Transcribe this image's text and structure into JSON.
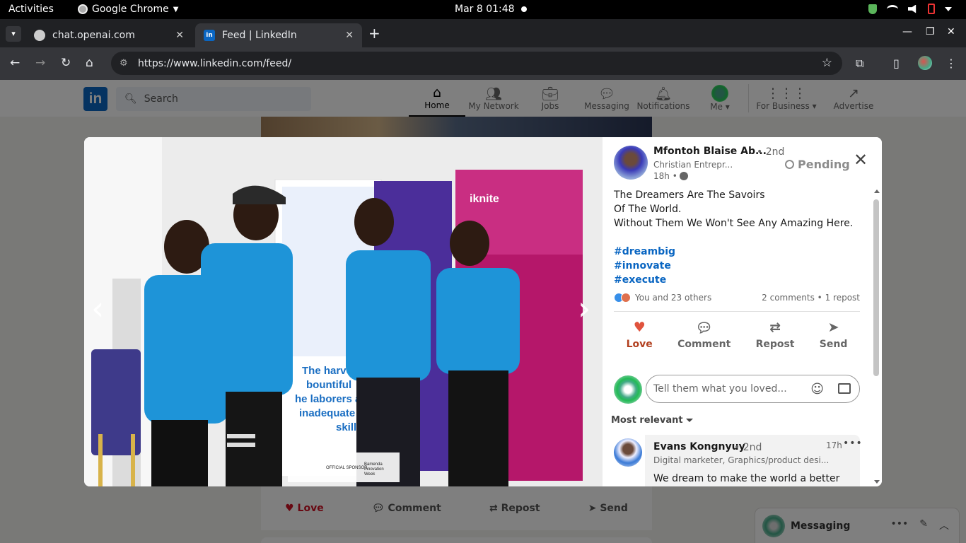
{
  "os": {
    "activities": "Activities",
    "app_name": "Google Chrome",
    "clock": "Mar 8  01:48"
  },
  "browser": {
    "tabs": [
      {
        "title": "chat.openai.com",
        "active": false
      },
      {
        "title": "Feed | LinkedIn",
        "active": true
      }
    ],
    "url": "https://www.linkedin.com/feed/"
  },
  "linkedin": {
    "search_placeholder": "Search",
    "nav": [
      {
        "label": "Home",
        "icon": "home-icon",
        "active": true
      },
      {
        "label": "My Network",
        "icon": "network-icon"
      },
      {
        "label": "Jobs",
        "icon": "briefcase-icon"
      },
      {
        "label": "Messaging",
        "icon": "chat-icon"
      },
      {
        "label": "Notifications",
        "icon": "bell-icon"
      },
      {
        "label": "Me ▾",
        "icon": "avatar"
      },
      {
        "label": "For Business ▾",
        "icon": "grid-icon"
      },
      {
        "label": "Advertise",
        "icon": "advertise-icon"
      }
    ],
    "bg_actions": {
      "love": "Love",
      "comment": "Comment",
      "repost": "Repost",
      "send": "Send"
    },
    "messaging_dock": {
      "title": "Messaging"
    }
  },
  "modal": {
    "photo_alt": "Four people in blue GreenHack Bamenda t-shirts standing in front of banners",
    "photo_text": {
      "harvest": "The harves bountiful he laborers a inadequate skille",
      "iknite": "iknite",
      "sponsor": "OFFICIAL SPONSOR",
      "event": "Bamenda Innovation Week"
    },
    "author": {
      "name": "Mfontoh Blaise Ab...",
      "degree": "• 2nd",
      "headline": "Christian Entrepr...",
      "time": "18h •",
      "status": "Pending"
    },
    "post_lines": [
      "The Dreamers Are The Savoirs",
      "Of The World.",
      "Without Them We Won't See Any Amazing Here."
    ],
    "hashtags": [
      "#dreambig",
      "#innovate",
      "#execute"
    ],
    "reactions_text": "You and 23 others",
    "counts_text": "2 comments • 1 repost",
    "actions": {
      "love": "Love",
      "comment": "Comment",
      "repost": "Repost",
      "send": "Send"
    },
    "comment_placeholder": "Tell them what you loved...",
    "sort_label": "Most relevant",
    "comments": [
      {
        "name": "Evans Kongnyuy",
        "degree": "• 2nd",
        "time": "17h",
        "headline": "Digital marketer, Graphics/product desi...",
        "text": "We dream to make the world a better"
      }
    ]
  }
}
